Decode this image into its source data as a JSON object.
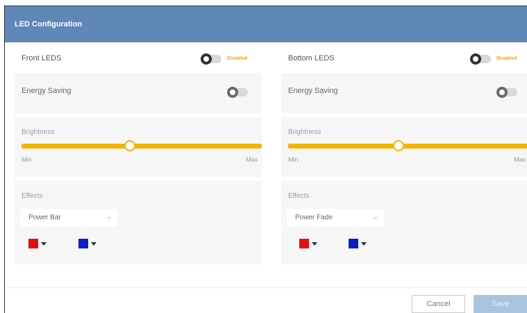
{
  "dialog": {
    "title": "LED Configuration"
  },
  "front": {
    "heading": "Front LEDS",
    "toggle_state": "Disabled",
    "energy_saving_label": "Energy Saving",
    "brightness_label": "Brightness",
    "brightness_value": 0.45,
    "min_label": "Min",
    "max_label": "Max",
    "effects_label": "Effects",
    "effect_value": "Power Bar",
    "color1": "#e01010",
    "color2": "#0a1fc8"
  },
  "bottom": {
    "heading": "Bottom LEDS",
    "toggle_state": "Disabled",
    "energy_saving_label": "Energy Saving",
    "brightness_label": "Brightness",
    "brightness_value": 0.46,
    "min_label": "Min",
    "max_label": "Max",
    "effects_label": "Effects",
    "effect_value": "Power Fade",
    "color1": "#e01010",
    "color2": "#0a1fc8"
  },
  "footer": {
    "cancel_label": "Cancel",
    "save_label": "Save"
  },
  "colors": {
    "header": "#5f87b8",
    "accent": "#f5b400",
    "state_text": "#f5a300"
  }
}
